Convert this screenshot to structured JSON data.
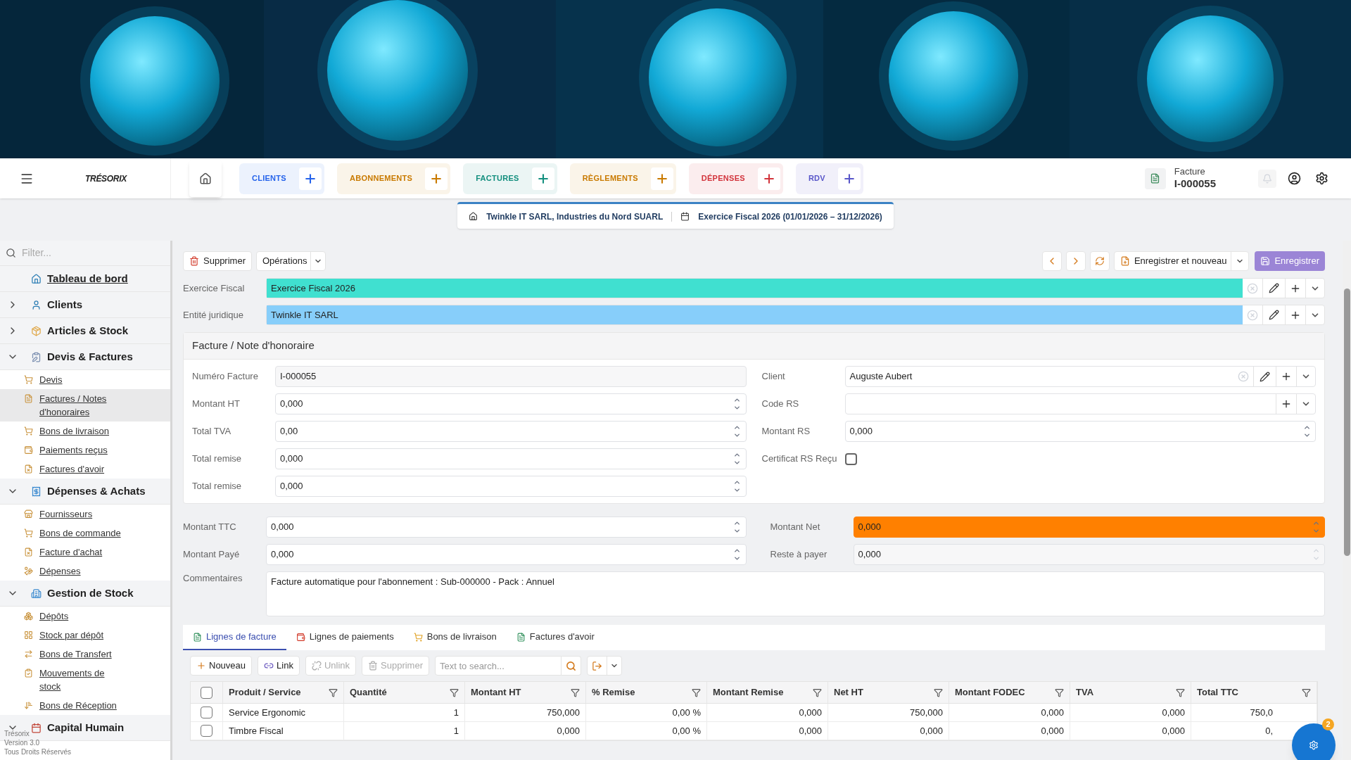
{
  "topbar": {
    "logo": "TRÉSORIX",
    "current_doc": {
      "label": "Facture",
      "number": "I-000055"
    }
  },
  "nav_tabs": [
    {
      "label": "CLIENTS",
      "color": "#2563eb"
    },
    {
      "label": "ABONNEMENTS",
      "color": "#c97a00"
    },
    {
      "label": "FACTURES",
      "color": "#138f7e"
    },
    {
      "label": "RÈGLEMENTS",
      "color": "#c97a00"
    },
    {
      "label": "DÉPENSES",
      "color": "#d2343c"
    },
    {
      "label": "RDV",
      "color": "#5856c9"
    }
  ],
  "context": {
    "company": "Twinkle IT SARL, Industries du Nord SUARL",
    "fiscal": "Exercice Fiscal 2026 (01/01/2026 – 31/12/2026)"
  },
  "sidebar": {
    "filter_placeholder": "Filter...",
    "items": [
      {
        "kind": "link",
        "label": "Tableau de bord"
      },
      {
        "kind": "group",
        "label": "Clients",
        "expanded": false
      },
      {
        "kind": "group",
        "label": "Articles & Stock",
        "expanded": false
      },
      {
        "kind": "group",
        "label": "Devis & Factures",
        "expanded": true,
        "children": [
          {
            "label": "Devis",
            "selected": false
          },
          {
            "label": "Factures / Notes d'honoraires",
            "selected": true
          },
          {
            "label": "Bons de livraison",
            "selected": false
          },
          {
            "label": "Paiements reçus",
            "selected": false
          },
          {
            "label": "Factures d'avoir",
            "selected": false
          }
        ]
      },
      {
        "kind": "group",
        "label": "Dépenses & Achats",
        "expanded": true,
        "children": [
          {
            "label": "Fournisseurs",
            "selected": false
          },
          {
            "label": "Bons de commande",
            "selected": false
          },
          {
            "label": "Facture d'achat",
            "selected": false
          },
          {
            "label": "Dépenses",
            "selected": false
          }
        ]
      },
      {
        "kind": "group",
        "label": "Gestion de Stock",
        "expanded": true,
        "children": [
          {
            "label": "Dépôts",
            "selected": false
          },
          {
            "label": "Stock par dépôt",
            "selected": false
          },
          {
            "label": "Bons de Transfert",
            "selected": false
          },
          {
            "label": "Mouvements de stock",
            "selected": false
          },
          {
            "label": "Bons de Réception",
            "selected": false
          }
        ]
      },
      {
        "kind": "group",
        "label": "Capital Humain",
        "expanded": true
      }
    ],
    "footer": [
      "Trésorix",
      "Version 3.0",
      "Tous Droits Réservés"
    ]
  },
  "toolbar": {
    "delete": "Supprimer",
    "operations": "Opérations",
    "save_new": "Enregistrer et nouveau",
    "save": "Enregistrer"
  },
  "top_fields": [
    {
      "label": "Exercice Fiscal",
      "value": "Exercice Fiscal 2026",
      "color": "#40e0d0"
    },
    {
      "label": "Entité juridique",
      "value": "Twinkle IT SARL",
      "color": "#87cefa"
    }
  ],
  "section": {
    "title": "Facture / Note d'honoraire",
    "left": [
      {
        "label": "Numéro Facture",
        "value": "I-000055",
        "kind": "text"
      },
      {
        "label": "Montant HT",
        "value": "0,000",
        "kind": "number"
      },
      {
        "label": "Total TVA",
        "value": "0,00",
        "kind": "number"
      },
      {
        "label": "Total remise",
        "value": "0,000",
        "kind": "number"
      },
      {
        "label": "Total remise",
        "value": "0,000",
        "kind": "number"
      }
    ],
    "right": [
      {
        "label": "Client",
        "value": "Auguste Aubert",
        "kind": "select"
      },
      {
        "label": "Code RS",
        "kind": "add"
      },
      {
        "label": "Montant RS",
        "value": "0,000",
        "kind": "number"
      },
      {
        "label": "Certificat RS Reçu",
        "kind": "checkbox",
        "checked": false
      }
    ]
  },
  "totals_left": [
    {
      "label": "Montant TTC",
      "value": "0,000"
    },
    {
      "label": "Montant Payé",
      "value": "0,000"
    }
  ],
  "totals_right": [
    {
      "label": "Montant Net",
      "value": "0,000",
      "color": "#ff8000",
      "disabled": false
    },
    {
      "label": "Reste à payer",
      "value": "0,000",
      "disabled": true
    }
  ],
  "comments": {
    "label": "Commentaires",
    "value": "Facture automatique pour l'abonnement : Sub-000000 - Pack : Annuel"
  },
  "tabs": [
    {
      "label": "Lignes de facture",
      "selected": true
    },
    {
      "label": "Lignes de paiements",
      "selected": false
    },
    {
      "label": "Bons de livraison",
      "selected": false
    },
    {
      "label": "Factures d'avoir",
      "selected": false
    }
  ],
  "grid_toolbar": {
    "new": "Nouveau",
    "link": "Link",
    "unlink": "Unlink",
    "delete": "Supprimer",
    "search_placeholder": "Text to search..."
  },
  "table": {
    "select_all": false,
    "columns": [
      "Produit / Service",
      "Quantité",
      "Montant HT",
      "% Remise",
      "Montant Remise",
      "Net HT",
      "Montant FODEC",
      "TVA",
      "Total TTC"
    ],
    "rows": [
      {
        "checked": false,
        "cells": [
          "Service Ergonomic",
          "1",
          "750,000",
          "0,00 %",
          "0,000",
          "750,000",
          "0,000",
          "0,000",
          "750,0"
        ]
      },
      {
        "checked": false,
        "cells": [
          "Timbre Fiscal",
          "1",
          "0,000",
          "0,00 %",
          "0,000",
          "0,000",
          "0,000",
          "0,000",
          "0,"
        ]
      }
    ]
  },
  "fab": {
    "badge": "2"
  }
}
